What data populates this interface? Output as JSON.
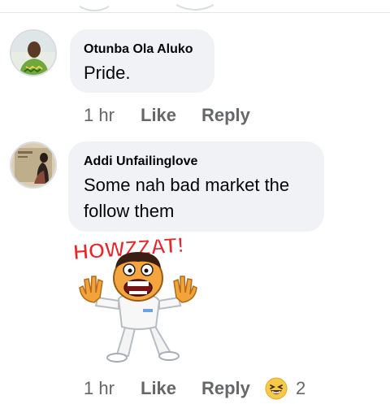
{
  "comments": [
    {
      "author": "Otunba Ola Aluko",
      "text": "Pride.",
      "time": "1 hr",
      "like_label": "Like",
      "reply_label": "Reply"
    },
    {
      "author": "Addi Unfailinglove",
      "text": "Some nah bad market the follow them",
      "sticker_text": "HOWZZAT!",
      "time": "1 hr",
      "like_label": "Like",
      "reply_label": "Reply",
      "reaction_icon": "laughing-emoji-icon",
      "reaction_count": "2"
    }
  ],
  "colors": {
    "bubble": "#f0f2f5",
    "meta_text": "#65676b",
    "author_text": "#050505",
    "sticker_red": "#e8252a"
  }
}
